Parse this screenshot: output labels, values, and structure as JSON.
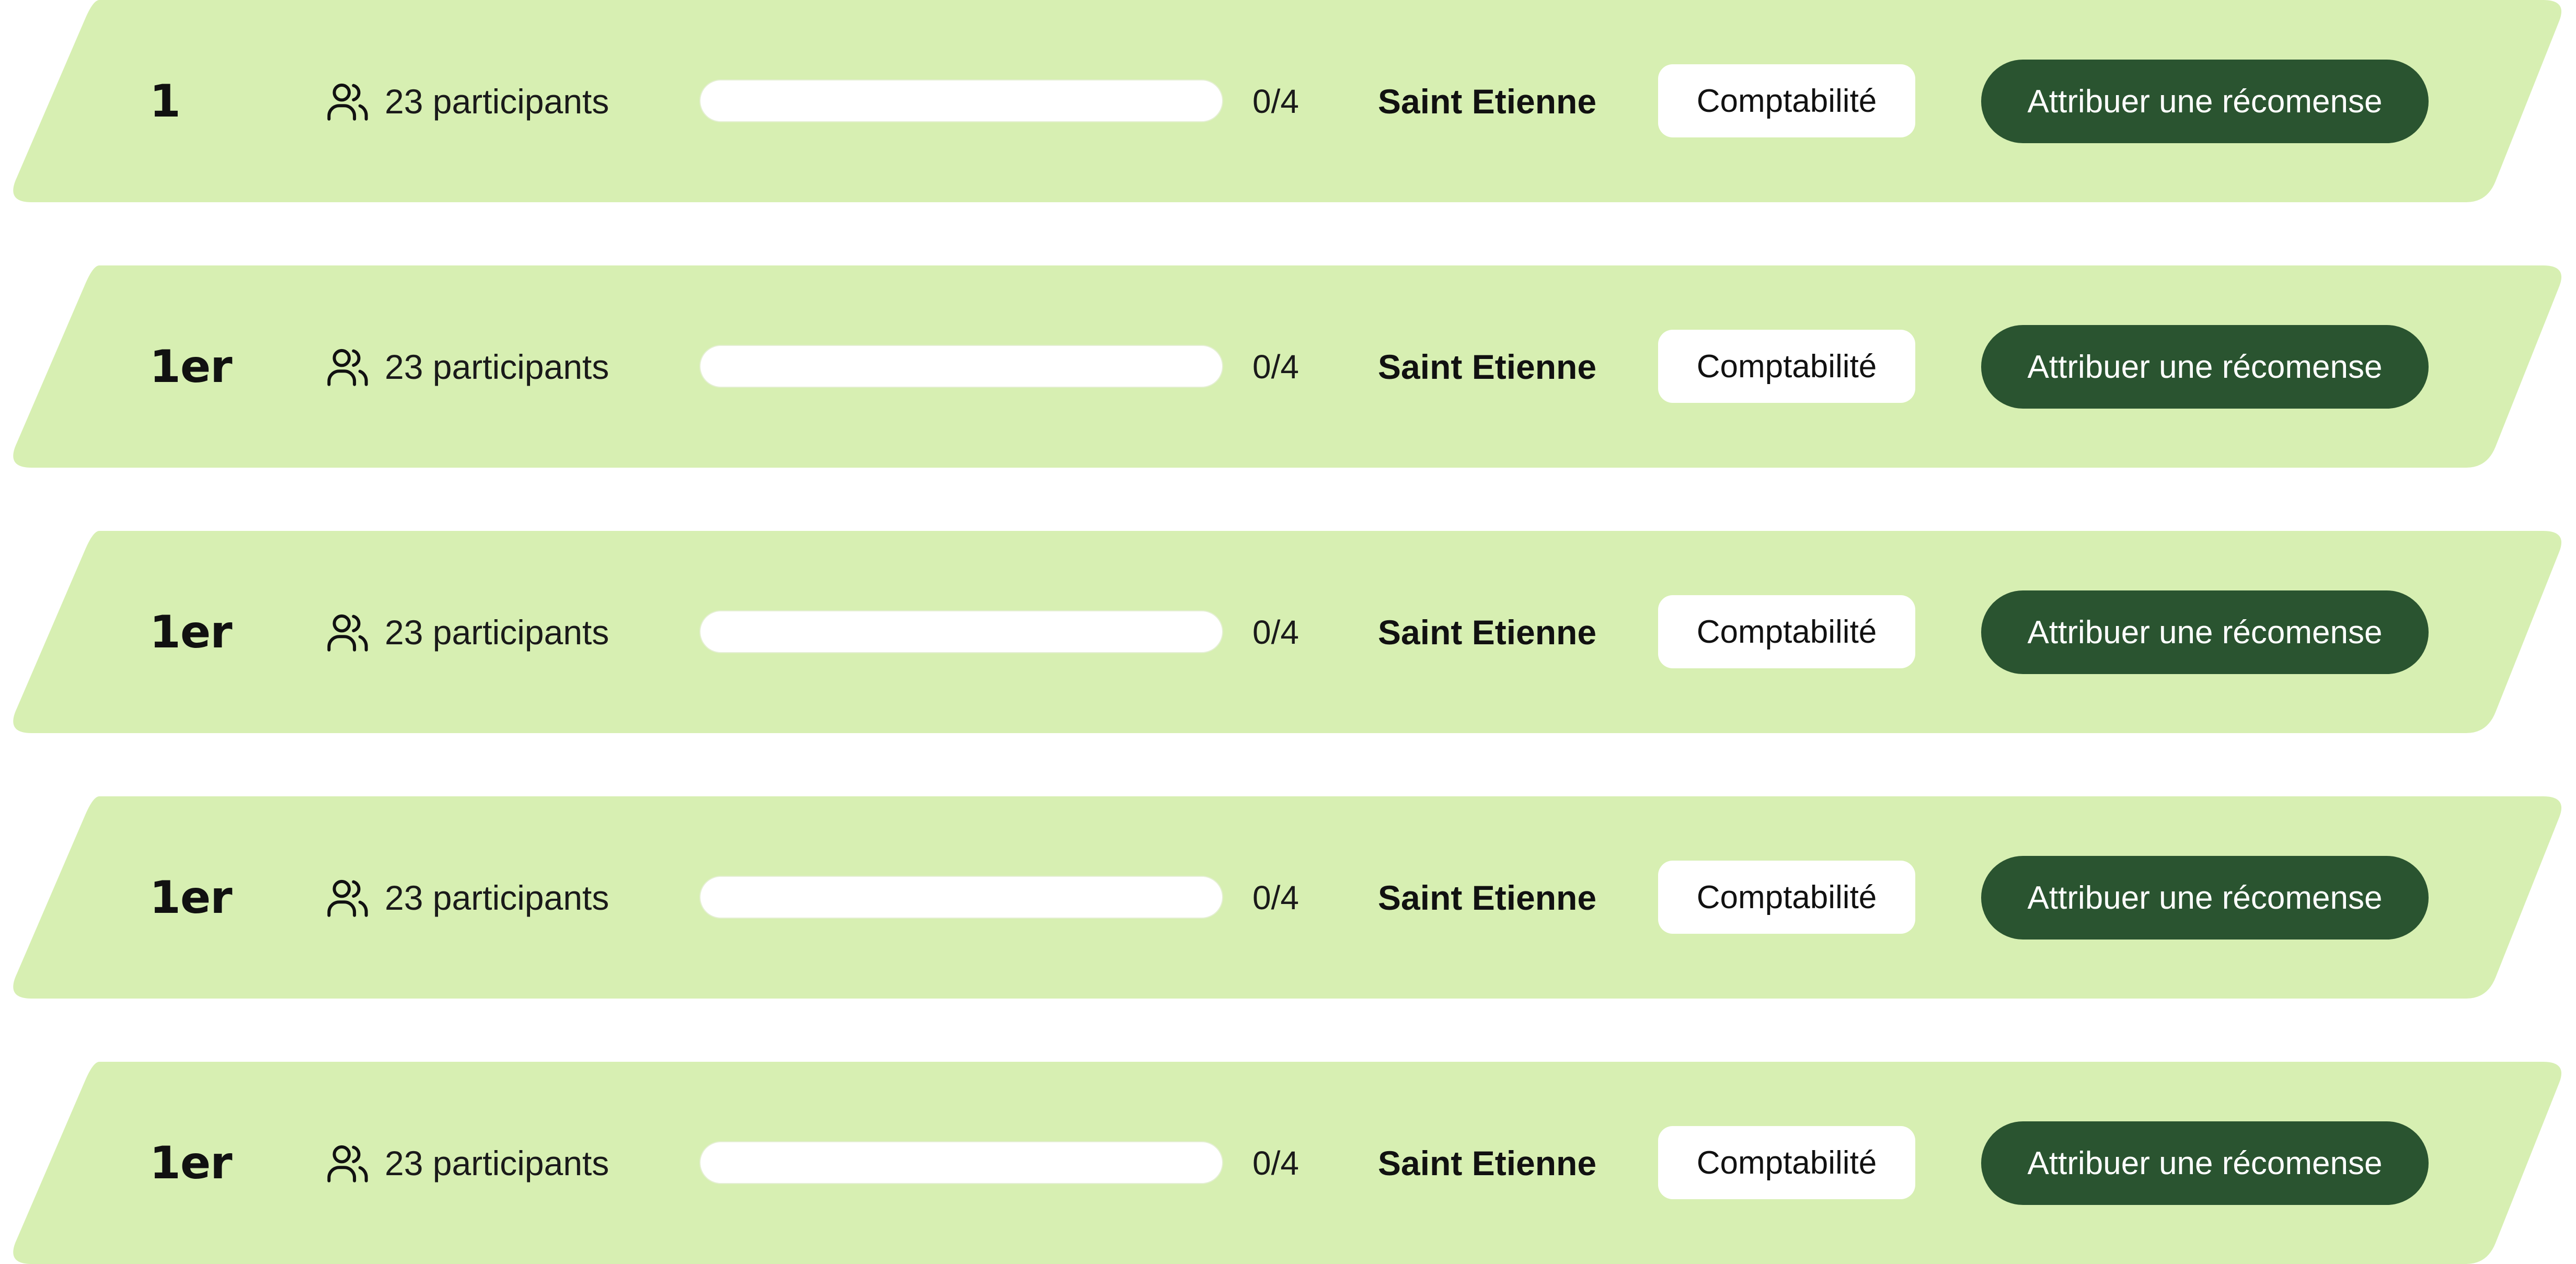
{
  "colors": {
    "row_background": "#d7efb2",
    "button_background": "#2a5430",
    "button_text": "#ffffff",
    "tag_background": "#ffffff",
    "progress_track": "#ffffff",
    "text": "#111111"
  },
  "rows": [
    {
      "rank": "1",
      "participants_icon": "users-icon",
      "participants_label": "23 participants",
      "progress_fraction": 0,
      "count": "0/4",
      "city": "Saint Etienne",
      "tag": "Comptabilité",
      "button_label": "Attribuer une récomense"
    },
    {
      "rank": "1er",
      "participants_icon": "users-icon",
      "participants_label": "23 participants",
      "progress_fraction": 0,
      "count": "0/4",
      "city": "Saint Etienne",
      "tag": "Comptabilité",
      "button_label": "Attribuer une récomense"
    },
    {
      "rank": "1er",
      "participants_icon": "users-icon",
      "participants_label": "23 participants",
      "progress_fraction": 0,
      "count": "0/4",
      "city": "Saint Etienne",
      "tag": "Comptabilité",
      "button_label": "Attribuer une récomense"
    },
    {
      "rank": "1er",
      "participants_icon": "users-icon",
      "participants_label": "23 participants",
      "progress_fraction": 0,
      "count": "0/4",
      "city": "Saint Etienne",
      "tag": "Comptabilité",
      "button_label": "Attribuer une récomense"
    },
    {
      "rank": "1er",
      "participants_icon": "users-icon",
      "participants_label": "23 participants",
      "progress_fraction": 0,
      "count": "0/4",
      "city": "Saint Etienne",
      "tag": "Comptabilité",
      "button_label": "Attribuer une récomense"
    }
  ]
}
